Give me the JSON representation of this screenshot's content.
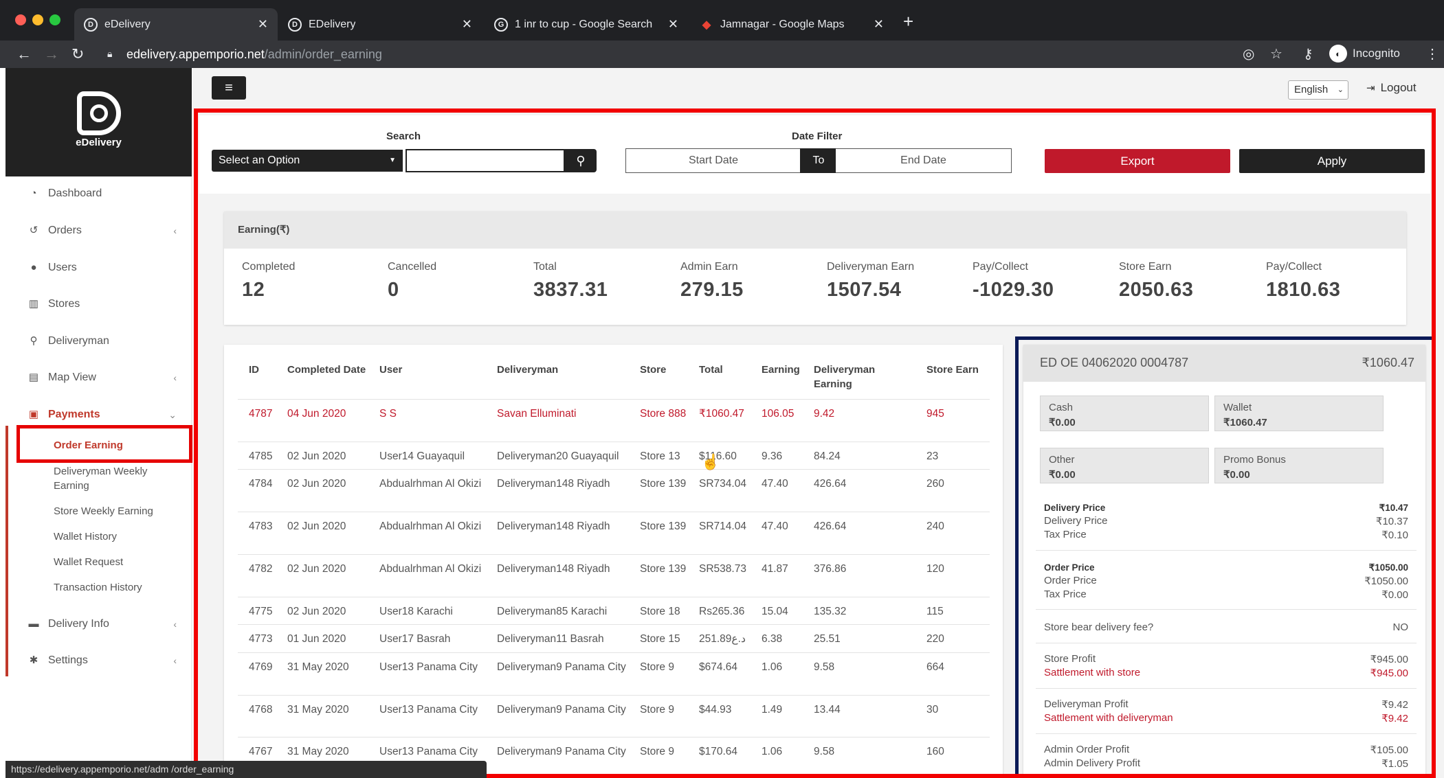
{
  "browser": {
    "tabs": [
      {
        "favicon": "D",
        "title": "eDelivery",
        "active": true
      },
      {
        "favicon": "D",
        "title": "EDelivery",
        "active": false
      },
      {
        "favicon": "G",
        "title": "1 inr to cup - Google Search",
        "active": false
      },
      {
        "favicon": "◆",
        "title": "Jamnagar - Google Maps",
        "active": false
      }
    ],
    "url_host": "edelivery.appemporio.net",
    "url_path": "/admin/order_earning",
    "incognito_label": "Incognito",
    "status_url": "https://edelivery.appemporio.net/adm   /order_earning"
  },
  "sidebar": {
    "brand": "eDelivery",
    "items": [
      {
        "label": "Dashboard",
        "icon": "dashboard-icon",
        "glyph": "◔",
        "chevron": ""
      },
      {
        "label": "Orders",
        "icon": "history-icon",
        "glyph": "↺",
        "chevron": "‹"
      },
      {
        "label": "Users",
        "icon": "user-icon",
        "glyph": "●",
        "chevron": ""
      },
      {
        "label": "Stores",
        "icon": "store-icon",
        "glyph": "▥",
        "chevron": ""
      },
      {
        "label": "Deliveryman",
        "icon": "bicycle-icon",
        "glyph": "⚲",
        "chevron": ""
      },
      {
        "label": "Map View",
        "icon": "map-icon",
        "glyph": "▤",
        "chevron": "‹"
      },
      {
        "label": "Payments",
        "icon": "money-icon",
        "glyph": "▣",
        "chevron": "⌄"
      },
      {
        "label": "Delivery Info",
        "icon": "truck-icon",
        "glyph": "▬",
        "chevron": "‹"
      },
      {
        "label": "Settings",
        "icon": "gear-icon",
        "glyph": "✱",
        "chevron": "‹"
      }
    ],
    "payments_submenu": [
      "Order Earning",
      "Deliveryman Weekly Earning",
      "Store Weekly Earning",
      "Wallet History",
      "Wallet Request",
      "Transaction History"
    ]
  },
  "header": {
    "language": "English",
    "logout": "Logout"
  },
  "filters": {
    "search_label": "Search",
    "select_placeholder": "Select an Option",
    "date_filter_label": "Date Filter",
    "start_date": "Start Date",
    "to": "To",
    "end_date": "End Date",
    "export": "Export",
    "apply": "Apply"
  },
  "earning": {
    "title": "Earning(₹)",
    "stats": [
      {
        "label": "Completed",
        "value": "12"
      },
      {
        "label": "Cancelled",
        "value": "0"
      },
      {
        "label": "Total",
        "value": "3837.31"
      },
      {
        "label": "Admin Earn",
        "value": "279.15"
      },
      {
        "label": "Deliveryman Earn",
        "value": "1507.54"
      },
      {
        "label": "Pay/Collect",
        "value": "-1029.30"
      },
      {
        "label": "Store Earn",
        "value": "2050.63"
      },
      {
        "label": "Pay/Collect",
        "value": "1810.63"
      }
    ]
  },
  "orders_table": {
    "columns": [
      "ID",
      "Completed Date",
      "User",
      "Deliveryman",
      "Store",
      "Total",
      "Earning",
      "Deliveryman Earning",
      "Store Earn"
    ],
    "rows": [
      [
        "4787",
        "04 Jun 2020",
        "S S",
        "Savan Elluminati",
        "Store 888",
        "₹1060.47",
        "106.05",
        "9.42",
        "945"
      ],
      [
        "4785",
        "02 Jun 2020",
        "User14 Guayaquil",
        "Deliveryman20 Guayaquil",
        "Store 13",
        "$116.60",
        "9.36",
        "84.24",
        "23"
      ],
      [
        "4784",
        "02 Jun 2020",
        "Abdualrhman Al Okizi",
        "Deliveryman148 Riyadh",
        "Store 139",
        "SR734.04",
        "47.40",
        "426.64",
        "260"
      ],
      [
        "4783",
        "02 Jun 2020",
        "Abdualrhman Al Okizi",
        "Deliveryman148 Riyadh",
        "Store 139",
        "SR714.04",
        "47.40",
        "426.64",
        "240"
      ],
      [
        "4782",
        "02 Jun 2020",
        "Abdualrhman Al Okizi",
        "Deliveryman148 Riyadh",
        "Store 139",
        "SR538.73",
        "41.87",
        "376.86",
        "120"
      ],
      [
        "4775",
        "02 Jun 2020",
        "User18 Karachi",
        "Deliveryman85 Karachi",
        "Store 18",
        "Rs265.36",
        "15.04",
        "135.32",
        "115"
      ],
      [
        "4773",
        "01 Jun 2020",
        "User17 Basrah",
        "Deliveryman11 Basrah",
        "Store 15",
        "251.89د.ع",
        "6.38",
        "25.51",
        "220"
      ],
      [
        "4769",
        "31 May 2020",
        "User13 Panama City",
        "Deliveryman9 Panama City",
        "Store 9",
        "$674.64",
        "1.06",
        "9.58",
        "664"
      ],
      [
        "4768",
        "31 May 2020",
        "User13 Panama City",
        "Deliveryman9 Panama City",
        "Store 9",
        "$44.93",
        "1.49",
        "13.44",
        "30"
      ],
      [
        "4767",
        "31 May 2020",
        "User13 Panama City",
        "Deliveryman9 Panama City",
        "Store 9",
        "$170.64",
        "1.06",
        "9.58",
        "160"
      ]
    ]
  },
  "order_detail": {
    "order_id": "ED OE 04062020 0004787",
    "amount": "₹1060.47",
    "payments": [
      {
        "label": "Cash",
        "value": "₹0.00"
      },
      {
        "label": "Wallet",
        "value": "₹1060.47"
      },
      {
        "label": "Other",
        "value": "₹0.00"
      },
      {
        "label": "Promo Bonus",
        "value": "₹0.00"
      }
    ],
    "delivery_price": {
      "head_label": "Delivery Price",
      "head_value": "₹10.47",
      "line1_label": "Delivery Price",
      "line1_value": "₹10.37",
      "line2_label": "Tax Price",
      "line2_value": "₹0.10"
    },
    "order_price": {
      "head_label": "Order Price",
      "head_value": "₹1050.00",
      "line1_label": "Order Price",
      "line1_value": "₹1050.00",
      "line2_label": "Tax Price",
      "line2_value": "₹0.00"
    },
    "store_bear_label": "Store bear delivery fee?",
    "store_bear_value": "NO",
    "store_profit_label": "Store Profit",
    "store_profit_value": "₹945.00",
    "store_settle_label": "Sattlement with store",
    "store_settle_value": "₹945.00",
    "dm_profit_label": "Deliveryman Profit",
    "dm_profit_value": "₹9.42",
    "dm_settle_label": "Sattlement with deliveryman",
    "dm_settle_value": "₹9.42",
    "admin_order_label": "Admin Order Profit",
    "admin_order_value": "₹105.00",
    "admin_delivery_label": "Admin Delivery Profit",
    "admin_delivery_value": "₹1.05"
  },
  "colors": {
    "accent_red": "#c0192b",
    "highlight_frame": "#f20000",
    "detail_frame": "#0b1a57",
    "dark": "#222222"
  }
}
